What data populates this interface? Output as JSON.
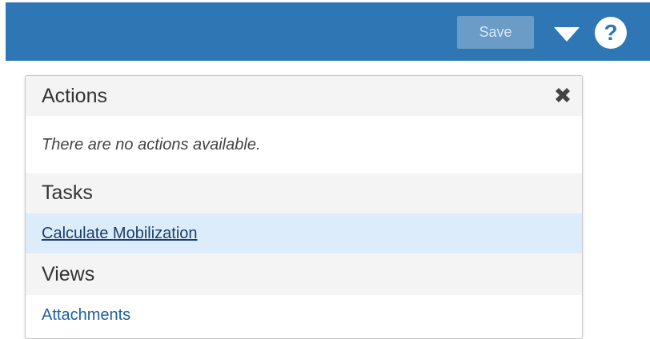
{
  "toolbar": {
    "save_label": "Save",
    "caret_icon": "caret-down-icon",
    "help_icon": "question-circle-icon",
    "accent": "#2f76b5"
  },
  "panel": {
    "actions_header": "Actions",
    "close_icon": "close-x-icon",
    "empty_message": "There are no actions available.",
    "tasks_header": "Tasks",
    "tasks": [
      {
        "label": "Calculate Mobilization"
      }
    ],
    "views_header": "Views",
    "views": [
      {
        "label": "Attachments"
      }
    ]
  }
}
